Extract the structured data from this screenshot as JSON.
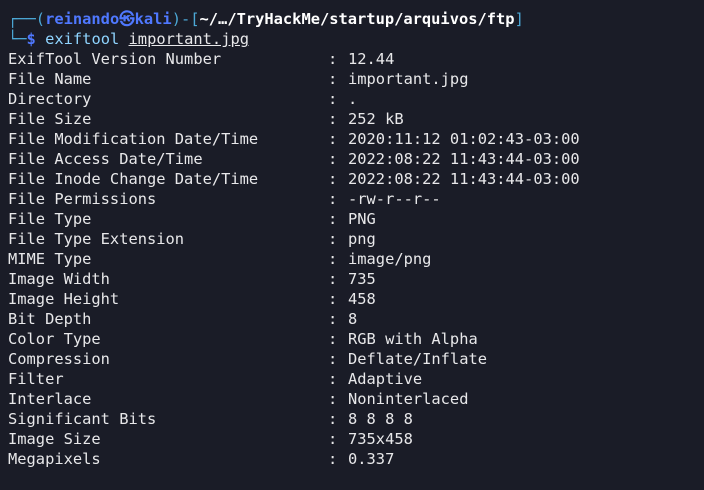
{
  "prompt": {
    "corner_top": "┌──(",
    "user": "reinando",
    "skull": "㉿",
    "host": "kali",
    "mid": ")-[",
    "path": "~/…/TryHackMe/startup/arquivos/ftp",
    "close": "]",
    "corner_bottom": "└─",
    "dollar": "$",
    "command": "exiftool",
    "argument": "important.jpg"
  },
  "separator": ":",
  "exif": [
    {
      "key": "ExifTool Version Number",
      "value": "12.44"
    },
    {
      "key": "File Name",
      "value": "important.jpg"
    },
    {
      "key": "Directory",
      "value": "."
    },
    {
      "key": "File Size",
      "value": "252 kB"
    },
    {
      "key": "File Modification Date/Time",
      "value": "2020:11:12 01:02:43-03:00"
    },
    {
      "key": "File Access Date/Time",
      "value": "2022:08:22 11:43:44-03:00"
    },
    {
      "key": "File Inode Change Date/Time",
      "value": "2022:08:22 11:43:44-03:00"
    },
    {
      "key": "File Permissions",
      "value": "-rw-r--r--"
    },
    {
      "key": "File Type",
      "value": "PNG"
    },
    {
      "key": "File Type Extension",
      "value": "png"
    },
    {
      "key": "MIME Type",
      "value": "image/png"
    },
    {
      "key": "Image Width",
      "value": "735"
    },
    {
      "key": "Image Height",
      "value": "458"
    },
    {
      "key": "Bit Depth",
      "value": "8"
    },
    {
      "key": "Color Type",
      "value": "RGB with Alpha"
    },
    {
      "key": "Compression",
      "value": "Deflate/Inflate"
    },
    {
      "key": "Filter",
      "value": "Adaptive"
    },
    {
      "key": "Interlace",
      "value": "Noninterlaced"
    },
    {
      "key": "Significant Bits",
      "value": "8 8 8 8"
    },
    {
      "key": "Image Size",
      "value": "735x458"
    },
    {
      "key": "Megapixels",
      "value": "0.337"
    }
  ]
}
